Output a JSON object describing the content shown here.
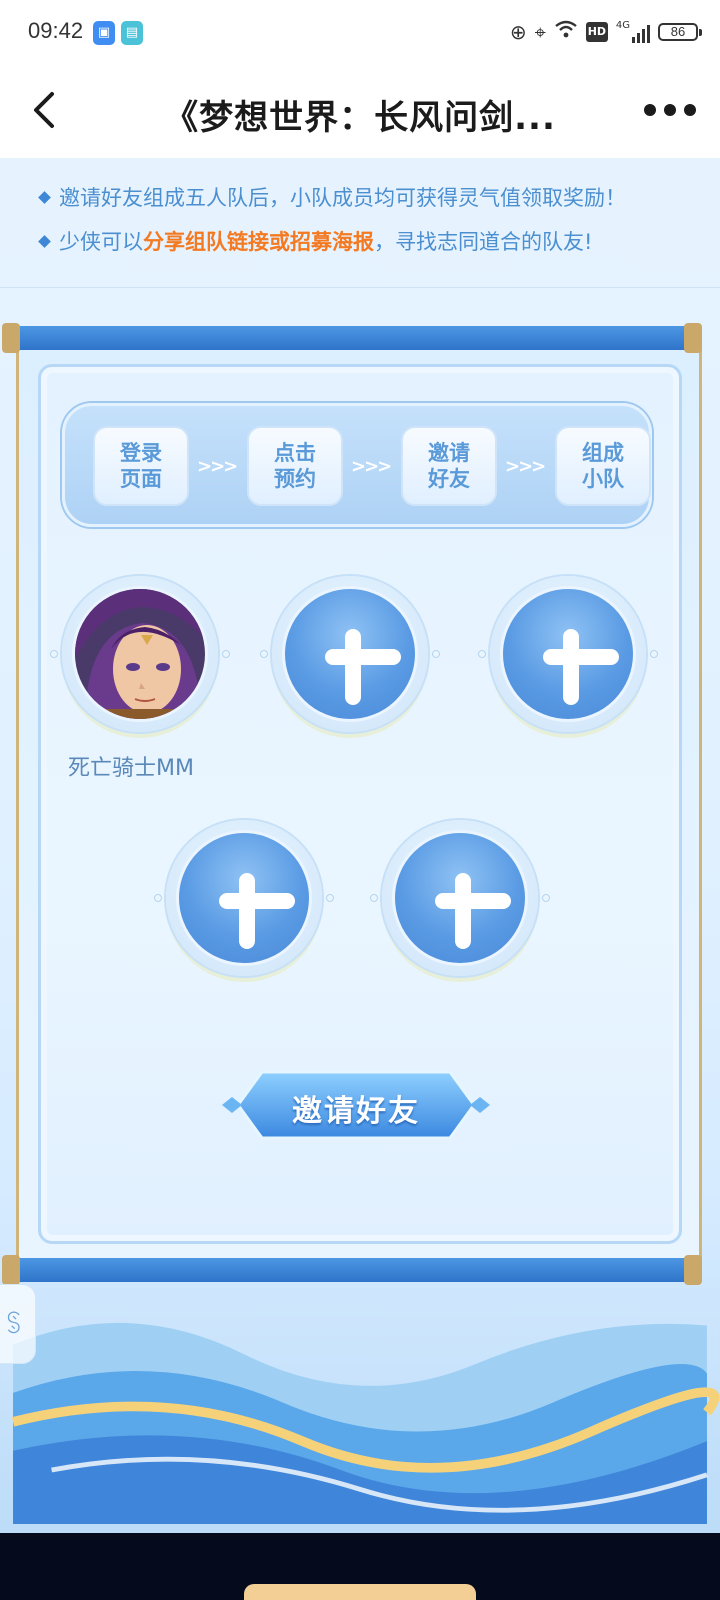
{
  "status_bar": {
    "time": "09:42",
    "battery": "86",
    "network": "4G",
    "hd_label": "HD",
    "icons": [
      "app-notification-icon",
      "trash-app-icon",
      "add-circle-icon",
      "location-icon",
      "wifi-icon",
      "signal-icon",
      "battery-icon"
    ]
  },
  "nav": {
    "title": "《梦想世界：长风问剑...",
    "back_icon": "chevron-left-icon",
    "more_icon": "more-dots-icon"
  },
  "tips": {
    "line1": "邀请好友组成五人队后，小队成员均可获得灵气值领取奖励！",
    "line2_prefix": "少侠可以",
    "line2_highlight": "分享组队链接或招募海报",
    "line2_suffix": "，寻找志同道合的队友!"
  },
  "steps": [
    {
      "label": "登录页面"
    },
    {
      "label": "点击预约"
    },
    {
      "label": "邀请好友"
    },
    {
      "label": "组成小队"
    }
  ],
  "step_arrow": ">>>",
  "team": {
    "member_name": "死亡骑士MM",
    "empty_slot_count": 4
  },
  "invite_button": {
    "label": "邀请好友"
  },
  "colors": {
    "accent_blue": "#4b8fd0",
    "highlight_orange": "#f47a22",
    "slot_blue": "#5a9be4",
    "home_pill": "#f3cf95"
  }
}
